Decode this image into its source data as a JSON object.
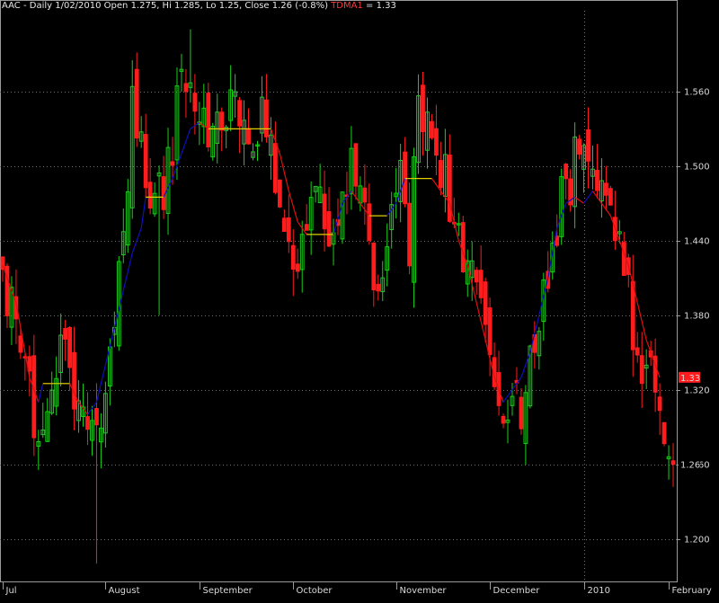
{
  "header": {
    "symbol": "AAC",
    "ohlc_text": " - Daily 1/02/2010 Open 1.275, Hi 1.285, Lo 1.25, Close 1.26 (-0.8%) ",
    "indicator_name": "TDMA1",
    "indicator_value_text": " = 1.33"
  },
  "colors": {
    "background": "#000000",
    "up_candle": "#18d018",
    "down_candle": "#ff1c1c",
    "ma_rising": "#1010c0",
    "ma_flat": "#e0d000",
    "ma_falling": "#e01010",
    "grid": "#707070",
    "axis_text": "#d9d9d9"
  },
  "badges": {
    "ma_last": "1.33",
    "close_last": "1.26"
  },
  "chart_data": {
    "type": "candlestick",
    "title": "",
    "ylim": [
      1.165,
      1.625
    ],
    "yticks": [
      "1.200",
      "1.260",
      "1.320",
      "1.380",
      "1.440",
      "1.500",
      "1.560"
    ],
    "grid": true,
    "legend": "none",
    "x_labels": [
      {
        "label": "Jul",
        "index": 0
      },
      {
        "label": "August",
        "index": 23
      },
      {
        "label": "September",
        "index": 44
      },
      {
        "label": "October",
        "index": 65
      },
      {
        "label": "November",
        "index": 88
      },
      {
        "label": "December",
        "index": 109
      },
      {
        "label": "2010",
        "index": 130
      },
      {
        "label": "February",
        "index": 149
      }
    ],
    "anchors": [
      [
        0,
        1.42
      ],
      [
        3,
        1.36
      ],
      [
        7,
        1.3
      ],
      [
        9,
        1.265
      ],
      [
        13,
        1.36
      ],
      [
        16,
        1.29
      ],
      [
        19,
        1.31
      ],
      [
        21,
        1.29
      ],
      [
        23,
        1.31
      ],
      [
        26,
        1.4
      ],
      [
        29,
        1.55
      ],
      [
        33,
        1.48
      ],
      [
        36,
        1.47
      ],
      [
        39,
        1.54
      ],
      [
        42,
        1.59
      ],
      [
        44,
        1.54
      ],
      [
        47,
        1.52
      ],
      [
        51,
        1.56
      ],
      [
        55,
        1.52
      ],
      [
        58,
        1.55
      ],
      [
        61,
        1.5
      ],
      [
        64,
        1.43
      ],
      [
        66,
        1.42
      ],
      [
        69,
        1.48
      ],
      [
        71,
        1.47
      ],
      [
        74,
        1.43
      ],
      [
        78,
        1.49
      ],
      [
        81,
        1.46
      ],
      [
        84,
        1.38
      ],
      [
        87,
        1.46
      ],
      [
        89,
        1.5
      ],
      [
        91,
        1.44
      ],
      [
        93,
        1.56
      ],
      [
        96,
        1.52
      ],
      [
        99,
        1.49
      ],
      [
        101,
        1.47
      ],
      [
        104,
        1.42
      ],
      [
        107,
        1.37
      ],
      [
        110,
        1.33
      ],
      [
        113,
        1.3
      ],
      [
        116,
        1.31
      ],
      [
        119,
        1.37
      ],
      [
        122,
        1.41
      ],
      [
        125,
        1.48
      ],
      [
        128,
        1.5
      ],
      [
        131,
        1.49
      ],
      [
        134,
        1.47
      ],
      [
        137,
        1.44
      ],
      [
        140,
        1.4
      ],
      [
        143,
        1.33
      ],
      [
        145,
        1.36
      ],
      [
        147,
        1.31
      ],
      [
        150,
        1.26
      ]
    ],
    "ma": [
      [
        0,
        1.42
      ],
      [
        3,
        1.39
      ],
      [
        6,
        1.33
      ],
      [
        8,
        1.31
      ],
      [
        9,
        1.325
      ],
      [
        12,
        1.325
      ],
      [
        15,
        1.325
      ],
      [
        17,
        1.31
      ],
      [
        19,
        1.3
      ],
      [
        21,
        1.31
      ],
      [
        23,
        1.34
      ],
      [
        25,
        1.37
      ],
      [
        27,
        1.4
      ],
      [
        29,
        1.43
      ],
      [
        31,
        1.45
      ],
      [
        32,
        1.475
      ],
      [
        36,
        1.475
      ],
      [
        38,
        1.49
      ],
      [
        40,
        1.51
      ],
      [
        42,
        1.53
      ],
      [
        44,
        1.535
      ],
      [
        46,
        1.53
      ],
      [
        60,
        1.53
      ],
      [
        62,
        1.51
      ],
      [
        64,
        1.48
      ],
      [
        66,
        1.455
      ],
      [
        68,
        1.445
      ],
      [
        72,
        1.445
      ],
      [
        74,
        1.445
      ],
      [
        76,
        1.47
      ],
      [
        78,
        1.48
      ],
      [
        80,
        1.47
      ],
      [
        82,
        1.46
      ],
      [
        86,
        1.46
      ],
      [
        88,
        1.47
      ],
      [
        90,
        1.49
      ],
      [
        92,
        1.49
      ],
      [
        96,
        1.49
      ],
      [
        98,
        1.48
      ],
      [
        100,
        1.47
      ],
      [
        102,
        1.44
      ],
      [
        104,
        1.42
      ],
      [
        106,
        1.39
      ],
      [
        108,
        1.36
      ],
      [
        110,
        1.33
      ],
      [
        112,
        1.31
      ],
      [
        114,
        1.32
      ],
      [
        116,
        1.33
      ],
      [
        118,
        1.35
      ],
      [
        120,
        1.38
      ],
      [
        122,
        1.41
      ],
      [
        124,
        1.45
      ],
      [
        126,
        1.47
      ],
      [
        128,
        1.475
      ],
      [
        130,
        1.47
      ],
      [
        132,
        1.48
      ],
      [
        134,
        1.47
      ],
      [
        136,
        1.46
      ],
      [
        138,
        1.44
      ],
      [
        140,
        1.42
      ],
      [
        142,
        1.39
      ],
      [
        144,
        1.36
      ],
      [
        146,
        1.34
      ],
      [
        147,
        1.33
      ]
    ],
    "last": {
      "close": 1.26,
      "ma": 1.33
    },
    "n_bars": 151
  }
}
